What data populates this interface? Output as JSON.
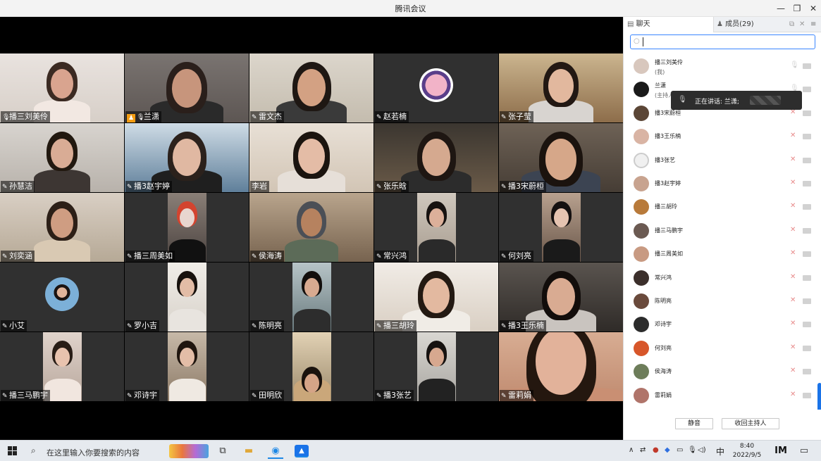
{
  "window": {
    "title": "腾讯会议",
    "minimize": "—",
    "restore": "❐",
    "close": "✕"
  },
  "tiles": [
    {
      "name": "播三刘美伶"
    },
    {
      "name": "兰潇",
      "host": true
    },
    {
      "name": "雷文杰"
    },
    {
      "name": "赵若楠"
    },
    {
      "name": "张子莹"
    },
    {
      "name": "孙慧洁"
    },
    {
      "name": "播3赵宇婷"
    },
    {
      "name": "李岩",
      "nomic": true
    },
    {
      "name": "张乐晗"
    },
    {
      "name": "播3宋蔚桓"
    },
    {
      "name": "刘奕涵"
    },
    {
      "name": "播三周美如"
    },
    {
      "name": "侯海涛"
    },
    {
      "name": "常兴鸿"
    },
    {
      "name": "何刘亮"
    },
    {
      "name": "小艾"
    },
    {
      "name": "罗小吉"
    },
    {
      "name": "陈明亮"
    },
    {
      "name": "播三胡玲"
    },
    {
      "name": "播3王乐楠"
    },
    {
      "name": "播三马鹏宇"
    },
    {
      "name": "邓诗宇"
    },
    {
      "name": "田明欣"
    },
    {
      "name": "播3张艺"
    },
    {
      "name": "雷莉娟"
    }
  ],
  "panel": {
    "tab_chat": "聊天",
    "tab_members": "成员(29)",
    "members": [
      {
        "name": "播三刘美伶",
        "sub": "(我)",
        "muted": false
      },
      {
        "name": "兰潇",
        "sub": "(主持人)",
        "muted": false
      },
      {
        "name": "播3宋蔚桓",
        "muted": true
      },
      {
        "name": "播3王乐楠",
        "muted": true
      },
      {
        "name": "播3张艺",
        "muted": true
      },
      {
        "name": "播3赵宇婷",
        "muted": true
      },
      {
        "name": "播三胡玲",
        "muted": true
      },
      {
        "name": "播三马鹏宇",
        "muted": true
      },
      {
        "name": "播三周美如",
        "muted": true
      },
      {
        "name": "常兴鸿",
        "muted": true
      },
      {
        "name": "陈明亮",
        "muted": true
      },
      {
        "name": "邓诗宇",
        "muted": true
      },
      {
        "name": "何刘亮",
        "muted": true
      },
      {
        "name": "侯海涛",
        "muted": true
      },
      {
        "name": "雷莉娟",
        "muted": true
      }
    ],
    "speaking": "正在讲话: 兰潇;",
    "btn_mute": "静音",
    "btn_reclaim_host": "收回主持人"
  },
  "taskbar": {
    "search_placeholder": "在这里输入你要搜索的内容",
    "time": "8:40",
    "date": "2022/9/5",
    "ime": "中"
  },
  "colors": {
    "accent": "#1a73e8",
    "host_tag": "#f39c12",
    "muted_mic": "#e88b8b"
  }
}
